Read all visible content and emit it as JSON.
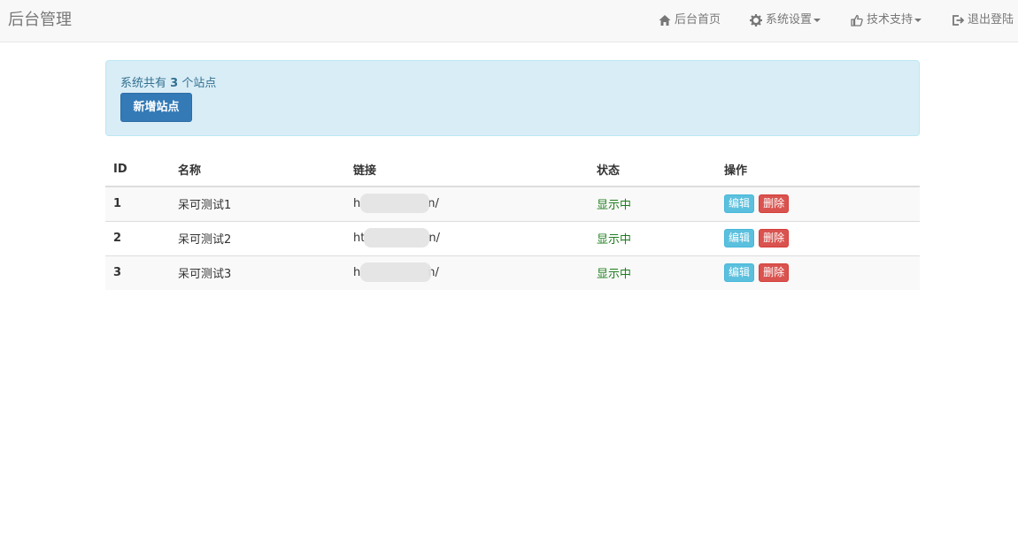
{
  "navbar": {
    "brand": "后台管理",
    "items": [
      {
        "label": "后台首页",
        "icon": "home-icon",
        "dropdown": false
      },
      {
        "label": "系统设置",
        "icon": "gear-icon",
        "dropdown": true
      },
      {
        "label": "技术支持",
        "icon": "thumbs-up-icon",
        "dropdown": true
      },
      {
        "label": "退出登陆",
        "icon": "logout-icon",
        "dropdown": false
      }
    ]
  },
  "alert": {
    "prefix": "系统共有 ",
    "count": "3",
    "suffix": " 个站点",
    "add_button": "新增站点"
  },
  "table": {
    "headers": [
      "ID",
      "名称",
      "链接",
      "状态",
      "操作"
    ],
    "rows": [
      {
        "id": "1",
        "name": "呆可测试1",
        "url_start": "h",
        "url_end": "n/",
        "status": "显示中",
        "edit": "编辑",
        "delete": "删除"
      },
      {
        "id": "2",
        "name": "呆可测试2",
        "url_start": "ht",
        "url_end": "n/",
        "status": "显示中",
        "edit": "编辑",
        "delete": "删除"
      },
      {
        "id": "3",
        "name": "呆可测试3",
        "url_start": "h",
        "url_end": "n/",
        "status": "显示中",
        "edit": "编辑",
        "delete": "删除"
      }
    ]
  },
  "colors": {
    "primary": "#337ab7",
    "info": "#5bc0de",
    "danger": "#d9534f",
    "status_green": "#1e7d1e",
    "alert_bg": "#d9edf7"
  }
}
